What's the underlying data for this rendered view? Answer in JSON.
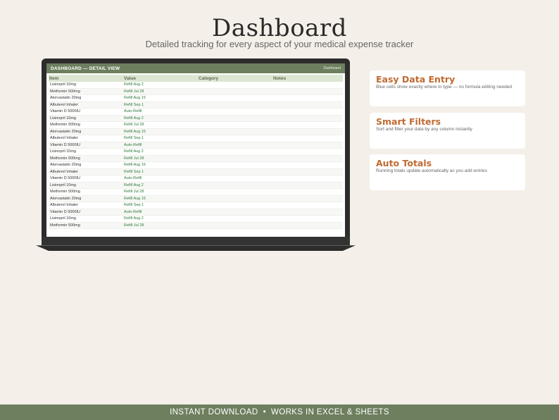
{
  "header": {
    "title": "Dashboard",
    "subtitle": "Detailed tracking for every aspect of your medical expense tracker"
  },
  "sheet": {
    "title": "DASHBOARD — DETAIL VIEW",
    "tab": "Dashboard",
    "columns": [
      "Item",
      "Value",
      "Category",
      "Notes"
    ],
    "rows": [
      {
        "item": "Lisinopril 10mg",
        "value": "Refill Aug 2"
      },
      {
        "item": "Metformin 500mg",
        "value": "Refill Jul 28"
      },
      {
        "item": "Atorvastatin 20mg",
        "value": "Refill Aug 15"
      },
      {
        "item": "Albuterol Inhaler",
        "value": "Refill Sep 1"
      },
      {
        "item": "Vitamin D 5000IU",
        "value": "Auto-Refill"
      },
      {
        "item": "Lisinopril 10mg",
        "value": "Refill Aug 2"
      },
      {
        "item": "Metformin 500mg",
        "value": "Refill Jul 28"
      },
      {
        "item": "Atorvastatin 20mg",
        "value": "Refill Aug 15"
      },
      {
        "item": "Albuterol Inhaler",
        "value": "Refill Sep 1"
      },
      {
        "item": "Vitamin D 5000IU",
        "value": "Auto-Refill"
      },
      {
        "item": "Lisinopril 10mg",
        "value": "Refill Aug 2"
      },
      {
        "item": "Metformin 500mg",
        "value": "Refill Jul 28"
      },
      {
        "item": "Atorvastatin 20mg",
        "value": "Refill Aug 15"
      },
      {
        "item": "Albuterol Inhaler",
        "value": "Refill Sep 1"
      },
      {
        "item": "Vitamin D 5000IU",
        "value": "Auto-Refill"
      },
      {
        "item": "Lisinopril 10mg",
        "value": "Refill Aug 2"
      },
      {
        "item": "Metformin 500mg",
        "value": "Refill Jul 28"
      },
      {
        "item": "Atorvastatin 20mg",
        "value": "Refill Aug 15"
      },
      {
        "item": "Albuterol Inhaler",
        "value": "Refill Sep 1"
      },
      {
        "item": "Vitamin D 5000IU",
        "value": "Auto-Refill"
      },
      {
        "item": "Lisinopril 10mg",
        "value": "Refill Aug 2"
      },
      {
        "item": "Metformin 500mg",
        "value": "Refill Jul 28"
      }
    ]
  },
  "features": [
    {
      "title": "Easy Data Entry",
      "desc": "Blue cells show exactly where to type — no formula editing needed"
    },
    {
      "title": "Smart Filters",
      "desc": "Sort and filter your data by any column instantly"
    },
    {
      "title": "Auto Totals",
      "desc": "Running totals update automatically as you add entries"
    }
  ],
  "footer": {
    "left": "INSTANT DOWNLOAD",
    "separator": "•",
    "right": "WORKS IN EXCEL & SHEETS"
  },
  "colors": {
    "accent_green": "#6d7f5e",
    "feature_orange": "#c06a32",
    "value_green": "#2f7a3b",
    "background": "#f4efe8"
  }
}
